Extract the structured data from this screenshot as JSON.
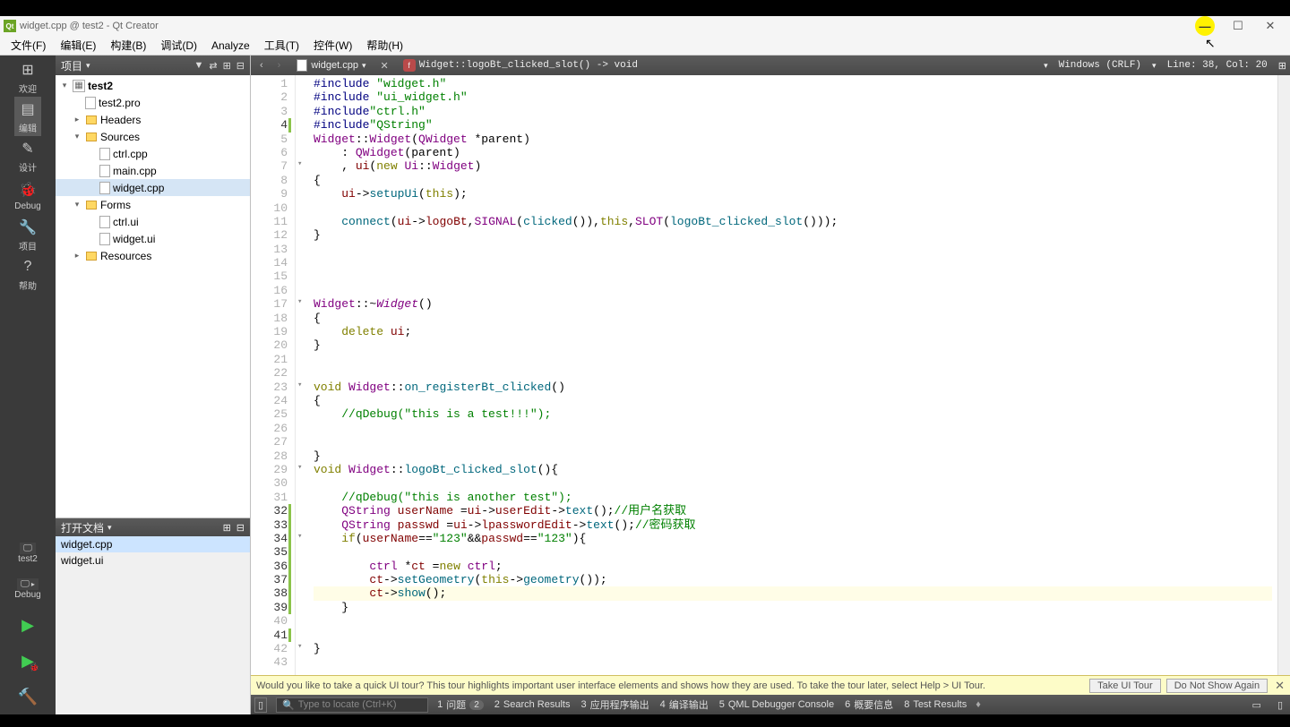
{
  "title": "widget.cpp @ test2 - Qt Creator",
  "menu": [
    "文件(F)",
    "编辑(E)",
    "构建(B)",
    "调试(D)",
    "Analyze",
    "工具(T)",
    "控件(W)",
    "帮助(H)"
  ],
  "modebar": {
    "items": [
      {
        "icon": "⊞",
        "label": "欢迎"
      },
      {
        "icon": "▤",
        "label": "编辑",
        "active": true
      },
      {
        "icon": "✎",
        "label": "设计"
      },
      {
        "icon": "🐞",
        "label": "Debug"
      },
      {
        "icon": "🔧",
        "label": "项目"
      },
      {
        "icon": "?",
        "label": "帮助"
      }
    ],
    "kit": "test2",
    "config": "Debug"
  },
  "project_header": "项目",
  "tree": [
    {
      "d": 0,
      "exp": "▾",
      "icon": "proj",
      "label": "test2",
      "bold": true
    },
    {
      "d": 1,
      "exp": "",
      "icon": "file",
      "label": "test2.pro"
    },
    {
      "d": 1,
      "exp": "▸",
      "icon": "yfolder",
      "label": "Headers"
    },
    {
      "d": 1,
      "exp": "▾",
      "icon": "yfolder",
      "label": "Sources"
    },
    {
      "d": 2,
      "exp": "",
      "icon": "file",
      "label": "ctrl.cpp"
    },
    {
      "d": 2,
      "exp": "",
      "icon": "file",
      "label": "main.cpp"
    },
    {
      "d": 2,
      "exp": "",
      "icon": "file",
      "label": "widget.cpp",
      "selected": true
    },
    {
      "d": 1,
      "exp": "▾",
      "icon": "yfolder",
      "label": "Forms"
    },
    {
      "d": 2,
      "exp": "",
      "icon": "file",
      "label": "ctrl.ui"
    },
    {
      "d": 2,
      "exp": "",
      "icon": "file",
      "label": "widget.ui"
    },
    {
      "d": 1,
      "exp": "▸",
      "icon": "yfolder",
      "label": "Resources"
    }
  ],
  "opendocs_header": "打开文档",
  "opendocs": [
    {
      "label": "widget.cpp",
      "selected": true
    },
    {
      "label": "widget.ui"
    }
  ],
  "editor": {
    "filename": "widget.cpp",
    "symbol": "Widget::logoBt_clicked_slot() -> void",
    "encoding": "Windows (CRLF)",
    "cursor": "Line: 38, Col: 20"
  },
  "code": [
    {
      "n": 1,
      "html": "<span class='k-pre'>#include</span> <span class='k-str'>\"widget.h\"</span>"
    },
    {
      "n": 2,
      "html": "<span class='k-pre'>#include</span> <span class='k-str'>\"ui_widget.h\"</span>"
    },
    {
      "n": 3,
      "html": "<span class='k-pre'>#include</span><span class='k-str'>\"ctrl.h\"</span>"
    },
    {
      "n": 4,
      "green": true,
      "html": "<span class='k-pre'>#include</span><span class='k-str'>\"QString\"</span>"
    },
    {
      "n": 5,
      "html": "<span class='k-type'>Widget</span>::<span class='k-type'>Widget</span>(<span class='k-type'>QWidget</span> *parent)"
    },
    {
      "n": 6,
      "html": "    : <span class='k-type'>QWidget</span>(parent)"
    },
    {
      "n": 7,
      "fold": "▾",
      "html": "    , <span class='k-red'>ui</span>(<span class='k-kw'>new</span> <span class='k-type'>Ui</span>::<span class='k-type'>Widget</span>)"
    },
    {
      "n": 8,
      "html": "{"
    },
    {
      "n": 9,
      "html": "    <span class='k-red'>ui</span>-><span class='k-fn'>setupUi</span>(<span class='k-kw'>this</span>);"
    },
    {
      "n": 10,
      "html": ""
    },
    {
      "n": 11,
      "html": "    <span class='k-fn'>connect</span>(<span class='k-red'>ui</span>-><span class='k-red'>logoBt</span>,<span class='k-type'>SIGNAL</span>(<span class='k-fn'>clicked</span>()),<span class='k-kw'>this</span>,<span class='k-type'>SLOT</span>(<span class='k-fn'>logoBt_clicked_slot</span>()));"
    },
    {
      "n": 12,
      "html": "}"
    },
    {
      "n": 13,
      "html": ""
    },
    {
      "n": 14,
      "html": ""
    },
    {
      "n": 15,
      "html": ""
    },
    {
      "n": 16,
      "html": ""
    },
    {
      "n": 17,
      "fold": "▾",
      "html": "<span class='k-type'>Widget</span>::~<span class='k-type k-ital'>Widget</span>()"
    },
    {
      "n": 18,
      "html": "{"
    },
    {
      "n": 19,
      "html": "    <span class='k-kw'>delete</span> <span class='k-red'>ui</span>;"
    },
    {
      "n": 20,
      "html": "}"
    },
    {
      "n": 21,
      "html": ""
    },
    {
      "n": 22,
      "html": ""
    },
    {
      "n": 23,
      "fold": "▾",
      "html": "<span class='k-kw'>void</span> <span class='k-type'>Widget</span>::<span class='k-fn'>on_registerBt_clicked</span>()"
    },
    {
      "n": 24,
      "html": "{"
    },
    {
      "n": 25,
      "html": "    <span class='k-cmt'>//qDebug(\"this is a test!!!\");</span>"
    },
    {
      "n": 26,
      "html": ""
    },
    {
      "n": 27,
      "html": ""
    },
    {
      "n": 28,
      "html": "}"
    },
    {
      "n": 29,
      "fold": "▾",
      "html": "<span class='k-kw'>void</span> <span class='k-type'>Widget</span>::<span class='k-fn'>logoBt_clicked_slot</span>(){"
    },
    {
      "n": 30,
      "html": ""
    },
    {
      "n": 31,
      "html": "    <span class='k-cmt'>//qDebug(\"this is another test\");</span>"
    },
    {
      "n": 32,
      "green": true,
      "html": "    <span class='k-type'>QString</span> <span class='k-red'>userName</span> =<span class='k-red'>ui</span>-><span class='k-red'>userEdit</span>-><span class='k-fn'>text</span>();<span class='k-cmt'>//用户名获取</span>"
    },
    {
      "n": 33,
      "green": true,
      "html": "    <span class='k-type'>QString</span> <span class='k-red'>passwd</span> =<span class='k-red'>ui</span>-><span class='k-red'>lpasswordEdit</span>-><span class='k-fn'>text</span>();<span class='k-cmt'>//密码获取</span>"
    },
    {
      "n": 34,
      "green": true,
      "fold": "▾",
      "html": "    <span class='k-kw'>if</span>(<span class='k-red'>userName</span>==<span class='k-str'>\"123\"</span>&&<span class='k-red'>passwd</span>==<span class='k-str'>\"123\"</span>){"
    },
    {
      "n": 35,
      "green": true,
      "html": ""
    },
    {
      "n": 36,
      "green": true,
      "html": "        <span class='k-type'>ctrl</span> *<span class='k-red'>ct</span> =<span class='k-kw'>new</span> <span class='k-type'>ctrl</span>;"
    },
    {
      "n": 37,
      "green": true,
      "html": "        <span class='k-red'>ct</span>-><span class='k-fn'>setGeometry</span>(<span class='k-kw'>this</span>-><span class='k-fn'>geometry</span>());"
    },
    {
      "n": 38,
      "green": true,
      "hl": true,
      "html": "        <span class='k-red'>ct</span>-><span class='k-fn'>show</span>();"
    },
    {
      "n": 39,
      "green": true,
      "html": "    }"
    },
    {
      "n": 40,
      "html": ""
    },
    {
      "n": 41,
      "green": true,
      "html": ""
    },
    {
      "n": 42,
      "fold": "▾",
      "html": "}"
    },
    {
      "n": 43,
      "html": ""
    }
  ],
  "infobar": {
    "text": "Would you like to take a quick UI tour? This tour highlights important user interface elements and shows how they are used. To take the tour later, select Help > UI Tour.",
    "btn1": "Take UI Tour",
    "btn2": "Do Not Show Again"
  },
  "bottom": {
    "locator_placeholder": "Type to locate (Ctrl+K)",
    "panes": [
      {
        "num": "1",
        "label": "问题",
        "badge": "2"
      },
      {
        "num": "2",
        "label": "Search Results"
      },
      {
        "num": "3",
        "label": "应用程序输出"
      },
      {
        "num": "4",
        "label": "编译输出"
      },
      {
        "num": "5",
        "label": "QML Debugger Console"
      },
      {
        "num": "6",
        "label": "概要信息"
      },
      {
        "num": "8",
        "label": "Test Results"
      }
    ]
  }
}
